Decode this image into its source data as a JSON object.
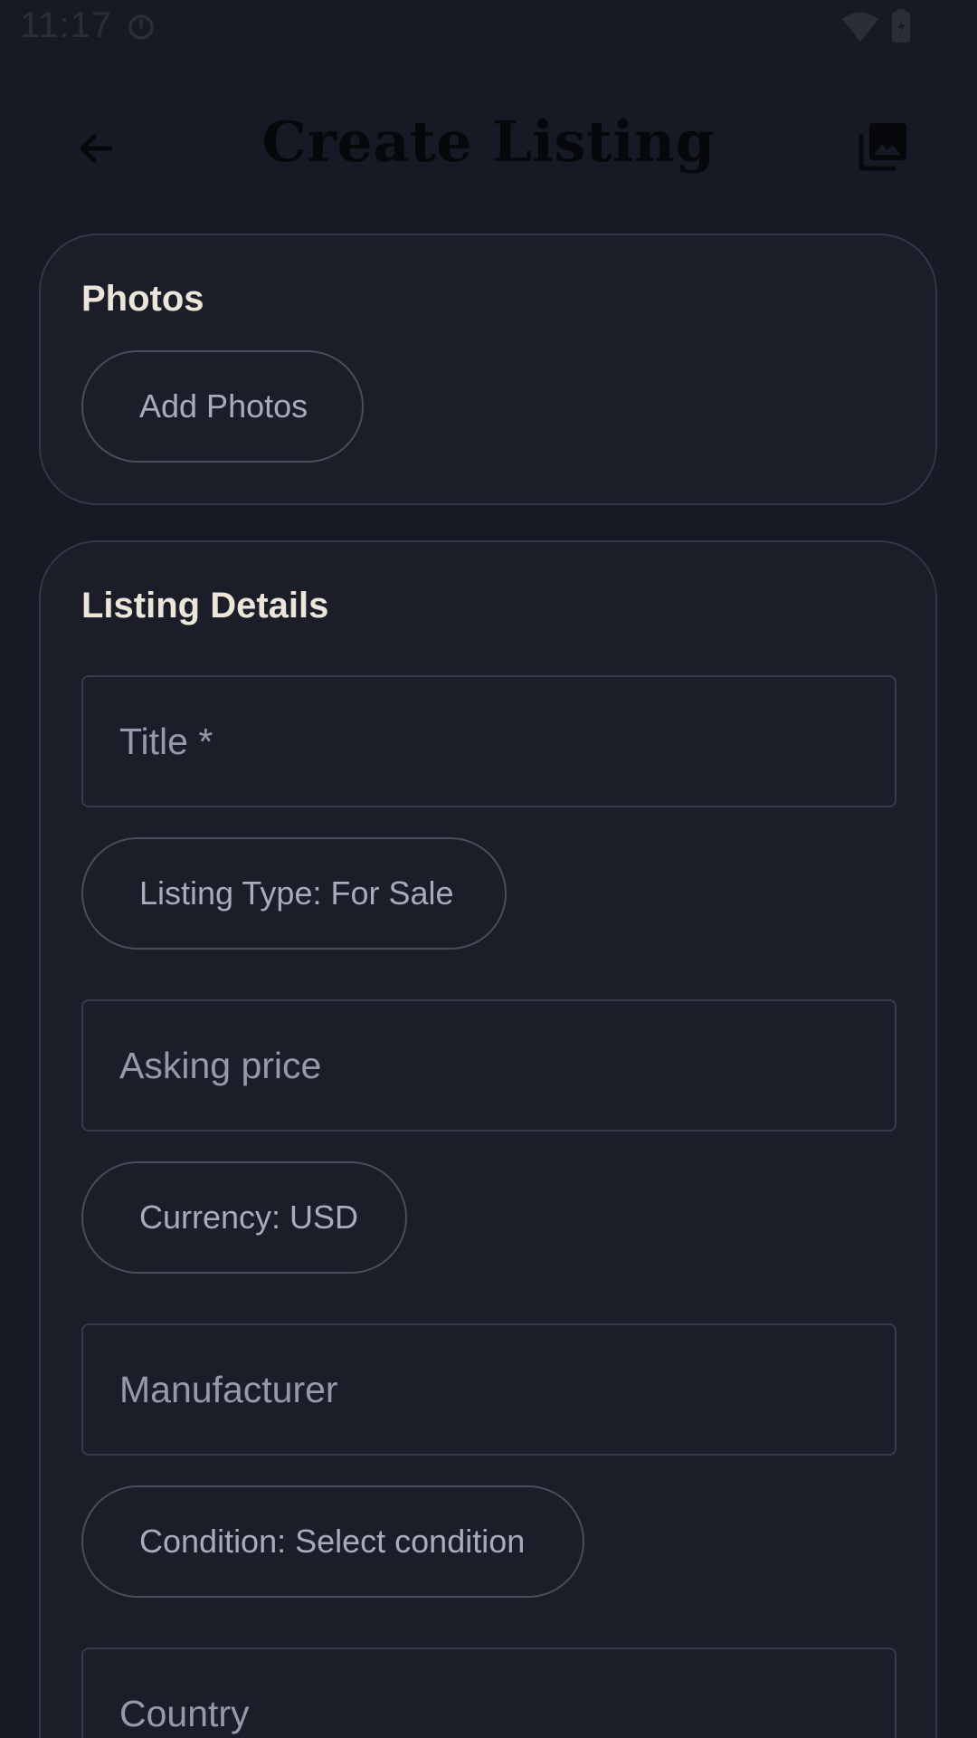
{
  "status_bar": {
    "time": "11:17"
  },
  "app_bar": {
    "title": "Create Listing",
    "back_icon": "arrow-back-icon",
    "action_icon": "photo-library-icon"
  },
  "photos_section": {
    "title": "Photos",
    "add_button_label": "Add Photos"
  },
  "details_section": {
    "title": "Listing Details",
    "title_field": {
      "placeholder": "Title *",
      "value": ""
    },
    "listing_type_label": "Listing Type: For Sale",
    "price_field": {
      "placeholder": "Asking price",
      "value": ""
    },
    "currency_label": "Currency: USD",
    "manufacturer_field": {
      "placeholder": "Manufacturer",
      "value": ""
    },
    "condition_label": "Condition: Select condition",
    "country_field": {
      "placeholder": "Country",
      "value": ""
    }
  },
  "colors": {
    "background": "#161a24",
    "card": "#1b1e29",
    "card_border": "#343846",
    "heading_text": "#ece6da",
    "muted_text": "#a6acbc"
  }
}
